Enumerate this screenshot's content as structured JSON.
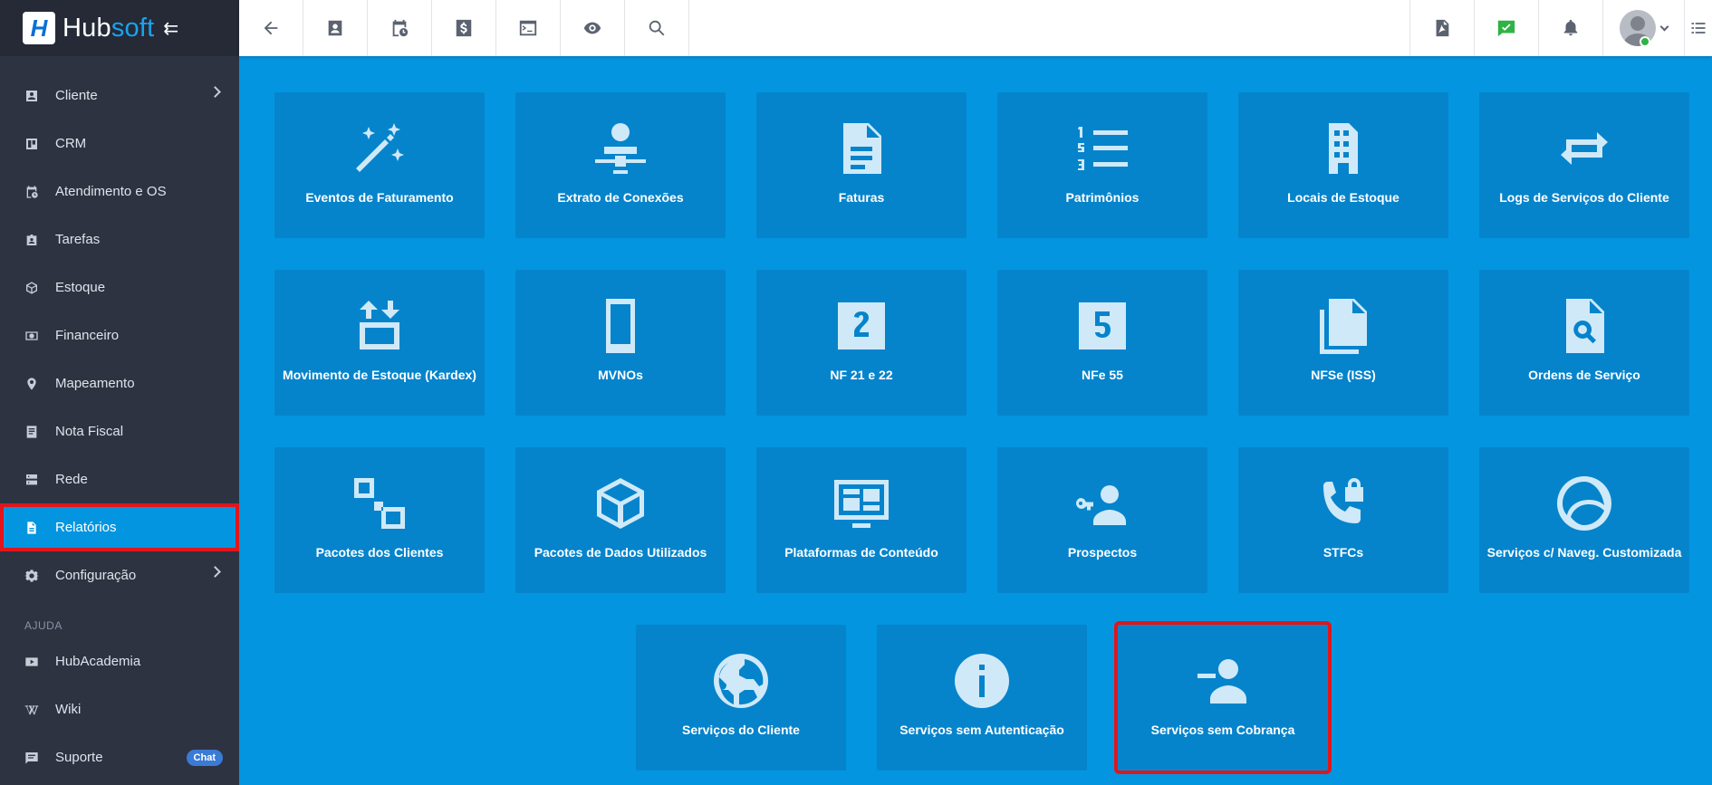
{
  "brand": {
    "hub": "Hub",
    "soft": "soft",
    "logo_letter": "H"
  },
  "sidebar": {
    "items": [
      {
        "label": "Cliente",
        "icon": "contact-card-icon",
        "has_children": true
      },
      {
        "label": "CRM",
        "icon": "trello-board-icon",
        "has_children": false
      },
      {
        "label": "Atendimento e OS",
        "icon": "calendar-clock-icon",
        "has_children": false
      },
      {
        "label": "Tarefas",
        "icon": "id-badge-icon",
        "has_children": false
      },
      {
        "label": "Estoque",
        "icon": "box-icon",
        "has_children": false
      },
      {
        "label": "Financeiro",
        "icon": "money-icon",
        "has_children": false
      },
      {
        "label": "Mapeamento",
        "icon": "map-pin-icon",
        "has_children": false
      },
      {
        "label": "Nota Fiscal",
        "icon": "receipt-icon",
        "has_children": false
      },
      {
        "label": "Rede",
        "icon": "server-icon",
        "has_children": false
      },
      {
        "label": "Relatórios",
        "icon": "document-icon",
        "has_children": false,
        "active": true
      },
      {
        "label": "Configuração",
        "icon": "gear-icon",
        "has_children": true
      }
    ],
    "help_section": "AJUDA",
    "help_items": [
      {
        "label": "HubAcademia",
        "icon": "youtube-icon"
      },
      {
        "label": "Wiki",
        "icon": "wikipedia-icon"
      },
      {
        "label": "Suporte",
        "icon": "chat-icon",
        "badge": "Chat"
      }
    ]
  },
  "topbar": {
    "left_icons": [
      "back-arrow-icon",
      "contact-icon",
      "calendar-clock-icon",
      "dollar-icon",
      "terminal-icon",
      "eye-icon",
      "search-icon"
    ],
    "right_icons": [
      "pdf-icon",
      "check-chat-icon",
      "bell-icon"
    ]
  },
  "reports": [
    {
      "label": "Eventos de Faturamento",
      "icon": "magic-wand-icon"
    },
    {
      "label": "Extrato de Conexões",
      "icon": "user-network-icon"
    },
    {
      "label": "Faturas",
      "icon": "file-text-icon"
    },
    {
      "label": "Patrimônios",
      "icon": "numbered-list-icon"
    },
    {
      "label": "Locais de Estoque",
      "icon": "building-icon"
    },
    {
      "label": "Logs de Serviços do Cliente",
      "icon": "repeat-icon"
    },
    {
      "label": "Movimento de Estoque (Kardex)",
      "icon": "arrows-box-icon"
    },
    {
      "label": "MVNOs",
      "icon": "smartphone-icon"
    },
    {
      "label": "NF 21 e 22",
      "icon": "number-2-box-icon"
    },
    {
      "label": "NFe 55",
      "icon": "number-5-box-icon"
    },
    {
      "label": "NFSe (ISS)",
      "icon": "files-icon"
    },
    {
      "label": "Ordens de Serviço",
      "icon": "file-search-icon"
    },
    {
      "label": "Pacotes dos Clientes",
      "icon": "squares-icon"
    },
    {
      "label": "Pacotes de Dados Utilizados",
      "icon": "package-icon"
    },
    {
      "label": "Plataformas de Conteúdo",
      "icon": "monitor-dashboard-icon"
    },
    {
      "label": "Prospectos",
      "icon": "user-key-icon"
    },
    {
      "label": "STFCs",
      "icon": "phone-lock-icon"
    },
    {
      "label": "Serviços c/ Naveg. Customizada",
      "icon": "globe-swirl-icon"
    },
    {
      "label": "Serviços do Cliente",
      "icon": "earth-icon"
    },
    {
      "label": "Serviços sem Autenticação",
      "icon": "info-icon"
    },
    {
      "label": "Serviços sem Cobrança",
      "icon": "user-minus-icon",
      "highlighted": true
    }
  ]
}
